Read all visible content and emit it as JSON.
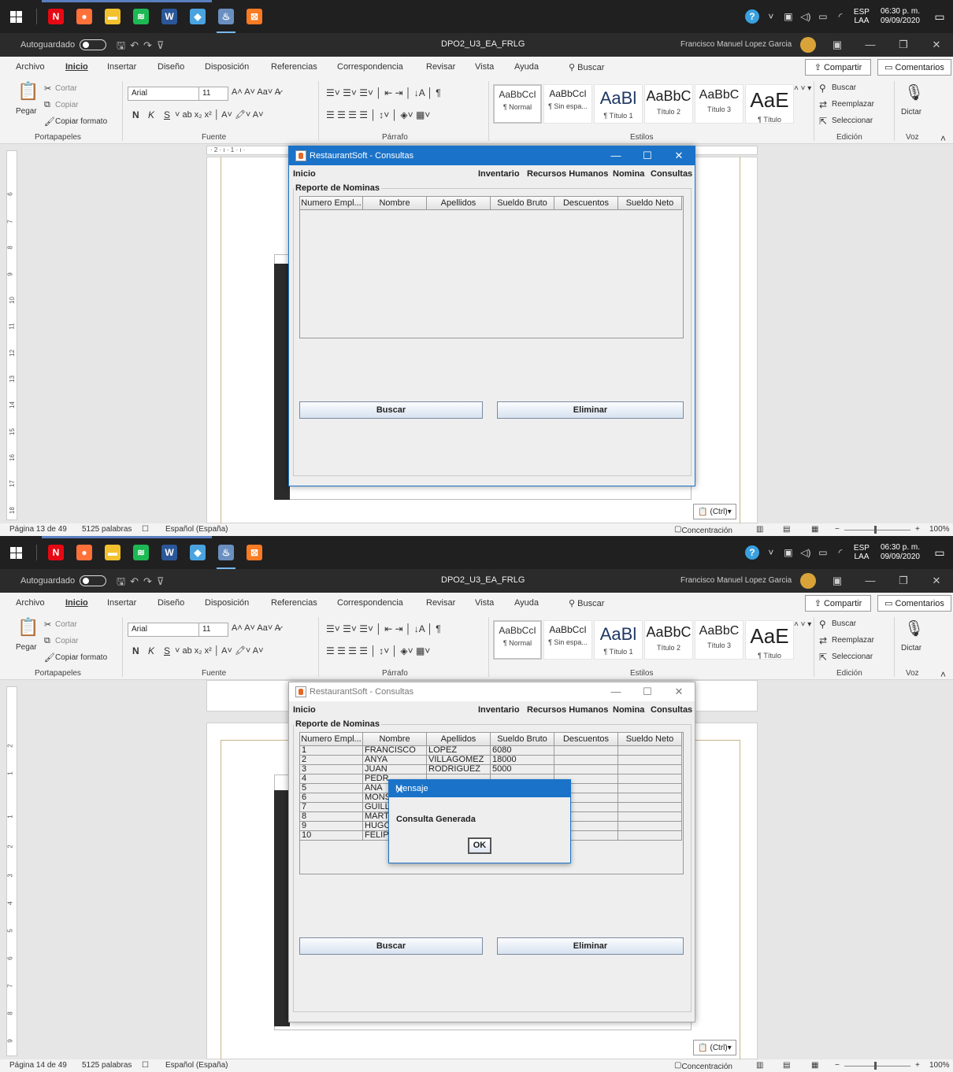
{
  "taskbar": {
    "apps": [
      {
        "icon": "netflix-icon",
        "glyph": "N",
        "color": "#e50914"
      },
      {
        "icon": "firefox-icon",
        "glyph": "●",
        "color": "#ff7139"
      },
      {
        "icon": "file-explorer-icon",
        "glyph": "▬",
        "color": "#f2c12e"
      },
      {
        "icon": "spotify-icon",
        "glyph": "≋",
        "color": "#1db954"
      },
      {
        "icon": "word-icon",
        "glyph": "W",
        "color": "#2b579a"
      },
      {
        "icon": "app-cube-icon",
        "glyph": "◆",
        "color": "#4aa3df"
      },
      {
        "icon": "java-app-icon",
        "glyph": "♨",
        "color": "#6a8fbf"
      },
      {
        "icon": "xampp-icon",
        "glyph": "⊠",
        "color": "#fb7a24"
      }
    ],
    "lang_top": "ESP",
    "lang_bottom": "LAA",
    "time": "06:30 p. m.",
    "date": "09/09/2020"
  },
  "word": {
    "autosave_label": "Autoguardado",
    "doc_title": "DPO2_U3_EA_FRLG",
    "user_name": "Francisco Manuel Lopez Garcia",
    "menu": [
      "Archivo",
      "Inicio",
      "Insertar",
      "Diseño",
      "Disposición",
      "Referencias",
      "Correspondencia",
      "Revisar",
      "Vista",
      "Ayuda"
    ],
    "search_label": "Buscar",
    "share_label": "Compartir",
    "comments_label": "Comentarios",
    "clipboard": {
      "paste": "Pegar",
      "cut": "Cortar",
      "copy": "Copiar",
      "format": "Copiar formato",
      "label": "Portapapeles"
    },
    "font": {
      "name": "Arial",
      "size": "11",
      "bold": "N",
      "italic": "K",
      "underline": "S",
      "label": "Fuente"
    },
    "paragraph_label": "Párrafo",
    "styles": [
      {
        "sample": "AaBbCcI",
        "name": "¶ Normal"
      },
      {
        "sample": "AaBbCcI",
        "name": "¶ Sin espa..."
      },
      {
        "sample": "AaBl",
        "name": "¶ Título 1"
      },
      {
        "sample": "AaBbC",
        "name": "Título 2"
      },
      {
        "sample": "AaBbC",
        "name": "Título 3"
      },
      {
        "sample": "AaE",
        "name": "¶ Título"
      }
    ],
    "styles_label": "Estilos",
    "editing": {
      "find": "Buscar",
      "replace": "Reemplazar",
      "select": "Seleccionar",
      "label": "Edición"
    },
    "voice": {
      "dictate": "Dictar",
      "label": "Voz"
    },
    "ctrl_label": "(Ctrl)",
    "status": {
      "page_top": "Página 13 de 49",
      "page_bottom": "Página 14 de 49",
      "words": "5125 palabras",
      "language": "Español (España)",
      "focus": "Concentración",
      "zoom": "100%"
    }
  },
  "app": {
    "title": "RestaurantSoft - Consultas",
    "menu": {
      "inicio": "Inicio",
      "inventario": "Inventario",
      "rrhh": "Recursos Humanos",
      "nomina": "Nomina",
      "consultas": "Consultas"
    },
    "panel_title": "Reporte de Nominas",
    "columns": [
      "Numero Empl...",
      "Nombre",
      "Apellidos",
      "Sueldo Bruto",
      "Descuentos",
      "Sueldo Neto"
    ],
    "rows": [
      [
        "1",
        "FRANCISCO",
        "LOPEZ",
        "6080",
        "",
        ""
      ],
      [
        "2",
        "ANYA",
        "VILLAGOMEZ",
        "18000",
        "",
        ""
      ],
      [
        "3",
        "JUAN",
        "RODRIGUEZ",
        "5000",
        "",
        ""
      ],
      [
        "4",
        "PEDR",
        "",
        "",
        "",
        ""
      ],
      [
        "5",
        "ANA",
        "",
        "",
        "",
        ""
      ],
      [
        "6",
        "MONS",
        "",
        "",
        "",
        ""
      ],
      [
        "7",
        "GUILL",
        "",
        "",
        "",
        ""
      ],
      [
        "8",
        "MART",
        "",
        "",
        "",
        ""
      ],
      [
        "9",
        "HUGC",
        "",
        "",
        "",
        ""
      ],
      [
        "10",
        "FELIP",
        "",
        "",
        "",
        ""
      ]
    ],
    "search_button": "Buscar",
    "delete_button": "Eliminar"
  },
  "dialog": {
    "title": "Mensaje",
    "message": "Consulta Generada",
    "ok": "OK"
  }
}
